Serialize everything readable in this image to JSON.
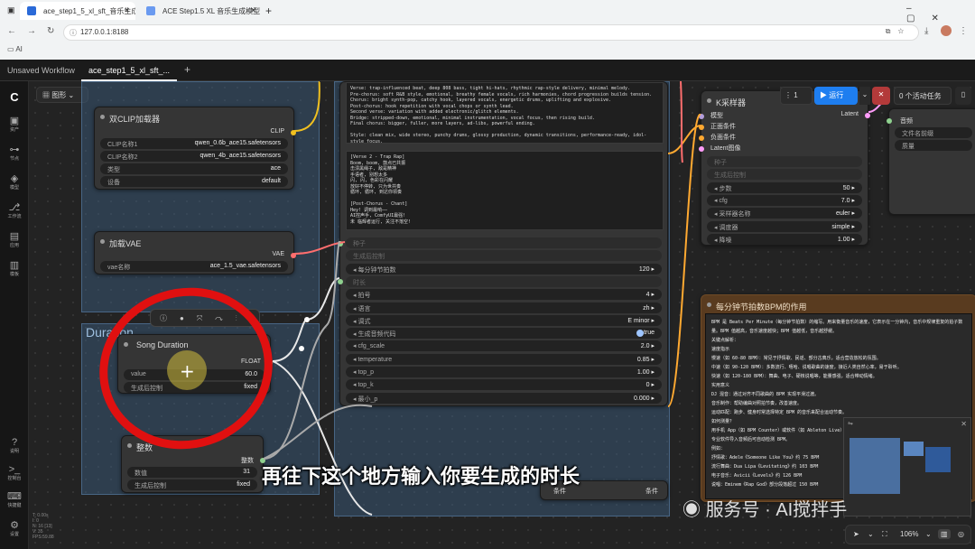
{
  "browser": {
    "tabs": [
      {
        "title": "ace_step1_5_xl_sft_音乐生成"
      },
      {
        "title": "ACE Step1.5 XL 音乐生成模型"
      }
    ],
    "url": "127.0.0.1:8188",
    "bookmark": "AI"
  },
  "app": {
    "tabs": [
      "Unsaved Workflow",
      "ace_step1_5_xl_sft_..."
    ],
    "graph_menu": "图形",
    "sidebar": [
      {
        "label": "资产",
        "icon": "image-icon"
      },
      {
        "label": "节点",
        "icon": "nodes-icon"
      },
      {
        "label": "模型",
        "icon": "model-icon"
      },
      {
        "label": "工作流",
        "icon": "workflow-icon"
      },
      {
        "label": "应用",
        "icon": "app-icon"
      },
      {
        "label": "模板",
        "icon": "template-icon"
      }
    ],
    "sidebar_bottom": [
      {
        "label": "说明",
        "icon": "help-icon"
      },
      {
        "label": "控制台",
        "icon": "terminal-icon"
      },
      {
        "label": "快捷键",
        "icon": "keyboard-icon"
      },
      {
        "label": "设置",
        "icon": "settings-icon"
      }
    ],
    "run": {
      "count": "1",
      "run_label": "运行",
      "active_tasks": "0 个活动任务"
    },
    "status": [
      "T: 0.00s",
      "I: 0",
      "N: 16 [13]",
      "V: 35",
      "FPS:59.88"
    ],
    "zoom": "106%"
  },
  "nodes": {
    "dual_clip": {
      "title": "双CLIP加载器",
      "output": "CLIP",
      "widgets": [
        {
          "label": "CLIP名称1",
          "value": "qwen_0.6b_ace15.safetensors"
        },
        {
          "label": "CLIP名称2",
          "value": "qwen_4b_ace15.safetensors"
        },
        {
          "label": "类型",
          "value": "ace"
        },
        {
          "label": "设备",
          "value": "default"
        }
      ]
    },
    "vae": {
      "title": "加载VAE",
      "output": "VAE",
      "widgets": [
        {
          "label": "vae名称",
          "value": "ace_1.5_vae.safetensors"
        }
      ]
    },
    "duration_group": {
      "title": "Duration"
    },
    "song_duration": {
      "title": "Song Duration",
      "output": "FLOAT",
      "widgets": [
        {
          "label": "value",
          "value": "60.0"
        },
        {
          "label": "生成后控制",
          "value": "fixed"
        }
      ]
    },
    "integer": {
      "title": "整数",
      "output": "整数",
      "widgets": [
        {
          "label": "数值",
          "value": "31"
        },
        {
          "label": "生成后控制",
          "value": "fixed"
        }
      ]
    },
    "encoder": {
      "tags_text": "Verse: trap-influenced beat, deep 808 bass, tight hi-hats, rhythmic rap-style delivery, minimal melody.\nPre-chorus: soft R&B style, emotional, breathy female vocals, rich harmonies, chord progression builds tension.\nChorus: bright synth-pop, catchy hook, layered vocals, energetic drums, uplifting and explosive.\nPost-chorus: hook repetition with vocal chops or synth lead.\nSecond verse: variation with added electronic/glitch elements.\nBridge: stripped-down, emotional, minimal instrumentation, vocal focus, then rising build.\nFinal chorus: bigger, fuller, more layers, ad-libs, powerful ending.\n\nStyle: clean mix, wide stereo, punchy drums, glossy production, dynamic transitions, performance-ready, idol-style focus.",
      "lyrics_text": "[Verse 2 - Trap Rap]\nBoom, boom, 鼓点已共振\n击溃黑绳子, 敌是精神\n手语者, 别想太多\n闪, 闪, 色彩在闪耀\n放好不停转, 只为世共奏\n循环, 循环, 到达你领奏\n\n[Post-Chorus - Chant]\nHey! 调到最响——\nAI控声手, ComfyUI最强!\n未 临辉者运行, 关注不落空!",
      "widgets": [
        {
          "label": "种子",
          "value": "",
          "disabled": true
        },
        {
          "label": "生成后控制",
          "value": "",
          "disabled": true
        },
        {
          "label": "每分钟节拍数",
          "value": "120"
        },
        {
          "label": "时长",
          "value": "",
          "disabled": true
        },
        {
          "label": "拍号",
          "value": "4"
        },
        {
          "label": "语言",
          "value": "zh"
        },
        {
          "label": "调式",
          "value": "E minor"
        },
        {
          "label": "生成音频代码",
          "value": "true"
        },
        {
          "label": "cfg_scale",
          "value": "2.0"
        },
        {
          "label": "temperature",
          "value": "0.85"
        },
        {
          "label": "top_p",
          "value": "1.00"
        },
        {
          "label": "top_k",
          "value": "0"
        },
        {
          "label": "最小_p",
          "value": "0.000"
        }
      ]
    },
    "ksampler": {
      "title": "K采样器",
      "inputs": [
        "模型",
        "正面条件",
        "负面条件",
        "Latent图像"
      ],
      "output": "Latent",
      "widgets": [
        {
          "label": "种子",
          "value": "",
          "disabled": true
        },
        {
          "label": "生成后控制",
          "value": "",
          "disabled": true
        },
        {
          "label": "步数",
          "value": "50"
        },
        {
          "label": "cfg",
          "value": "7.0"
        },
        {
          "label": "采样器名称",
          "value": "euler"
        },
        {
          "label": "调度器",
          "value": "simple"
        },
        {
          "label": "降噪",
          "value": "1.00"
        }
      ]
    },
    "save_audio": {
      "input": "音频",
      "widgets": [
        {
          "label": "文件名前缀",
          "value": ""
        },
        {
          "label": "质量",
          "value": ""
        }
      ]
    },
    "bpm_note": {
      "title": "每分钟节拍数BPM的作用",
      "lines": [
        "BPM 是 Beats Per Minute（每分钟节拍数）的缩写。用来衡量音乐的速度，它表示在一分钟内，音乐中规律重复的拍子数量。BPM 值越高，音乐速度越快；BPM 值越低，音乐越舒缓。",
        "关键点解析：",
        "速度指示",
        "慢速（如 60-80 BPM）：常见于抒情歌、民谣、部分古典乐，适合营造放松的氛围。",
        "中速（如 90-120 BPM）：多数流行、嘻哈、说唱歌曲的速度，接近人类自然心率，易于聆听。",
        "快速（如 120-180 BPM）：舞曲、电子、硬核说唱等，能量感强，适合带动情绪。",
        "实用意义",
        "DJ 混音：通过对齐不同歌曲的 BPM 实现平滑过渡。",
        "音乐制作：帮助编曲对照拍节奏，改善速度。",
        "运动匹配：跑步、健身时常选择特定 BPM 的音乐来配合运动节奏。",
        "如何测量？",
        "用手机 App（如 BPM Counter）或软件（如 Ableton Live）测量。",
        "专业软件导入音频后可自动检测 BPM。",
        "例如：",
        "抒情歌：Adele《Someone Like You》约 75 BPM",
        "流行舞曲：Dua Lipa《Levitating》约 103 BPM",
        "电子音乐：Avicii《Levels》约 126 BPM",
        "说唱：Eminem《Rap God》部分段落超过 150 BPM"
      ],
      "footer": [
        "条件",
        "条件"
      ]
    }
  },
  "overlay": {
    "subtitle": "再往下这个地方输入你要生成的时长",
    "watermark": "服务号 · AI搅拌手",
    "circle_color": "#e01010",
    "cursor_icon": "plus-cursor-icon"
  }
}
